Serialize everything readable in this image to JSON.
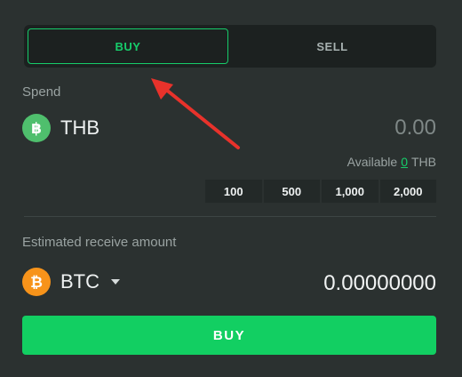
{
  "trade_toggle": {
    "buy_label": "BUY",
    "sell_label": "SELL",
    "active": "buy"
  },
  "spend": {
    "label": "Spend",
    "currency_code": "THB",
    "currency_icon": "thb-coin-icon",
    "amount_placeholder": "0.00",
    "available_prefix": "Available",
    "available_amount": "0",
    "available_currency": "THB",
    "quick_amounts": [
      "100",
      "500",
      "1,000",
      "2,000"
    ]
  },
  "receive": {
    "label": "Estimated receive amount",
    "currency_code": "BTC",
    "currency_icon": "btc-coin-icon",
    "amount": "0.00000000"
  },
  "submit": {
    "label": "BUY"
  },
  "colors": {
    "accent": "#16cc6a",
    "btc": "#f7931a",
    "thb": "#4fbf6d",
    "background": "#2b3130",
    "annotation": "#e8322b"
  }
}
